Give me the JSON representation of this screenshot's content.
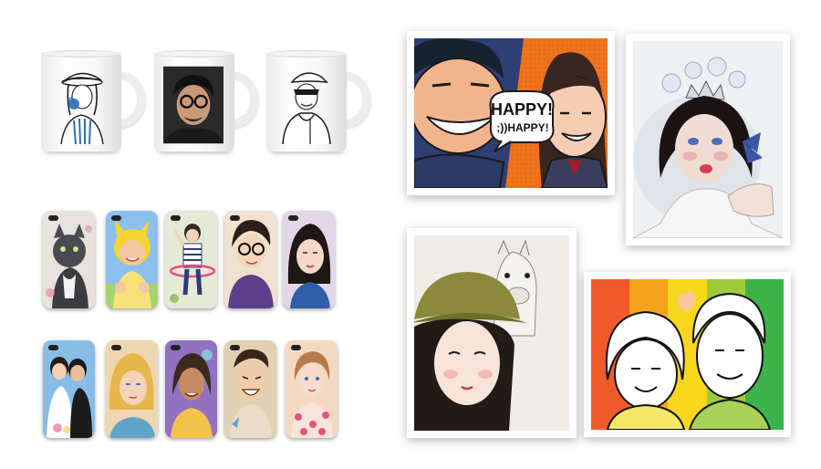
{
  "speech_bubble": {
    "line1": "HAPPY!",
    "line2": ";))HAPPY!"
  },
  "colors": {
    "background": "#ffffff",
    "line_art": "#1a1a1a",
    "pop_orange": "#f0731e",
    "rainbow": [
      "#f05a2a",
      "#f7a21b",
      "#f9d71c",
      "#9ccc3c",
      "#3db349"
    ]
  },
  "products": {
    "mugs": [
      "girl-with-hat-sketch",
      "man-with-glasses-photo",
      "person-in-cap-sketch"
    ],
    "phone_cases": [
      "cat",
      "baby-in-chick-hat",
      "child-with-hula-hoop",
      "man-with-glasses",
      "woman-portrait",
      "couple",
      "blonde-woman",
      "woman-purple",
      "laughing-man",
      "child-pink-dots"
    ],
    "frames": [
      "pop-art-couple",
      "watercolor-girl-with-crown",
      "girl-with-alpaca",
      "rainbow-couple-caricature"
    ]
  }
}
